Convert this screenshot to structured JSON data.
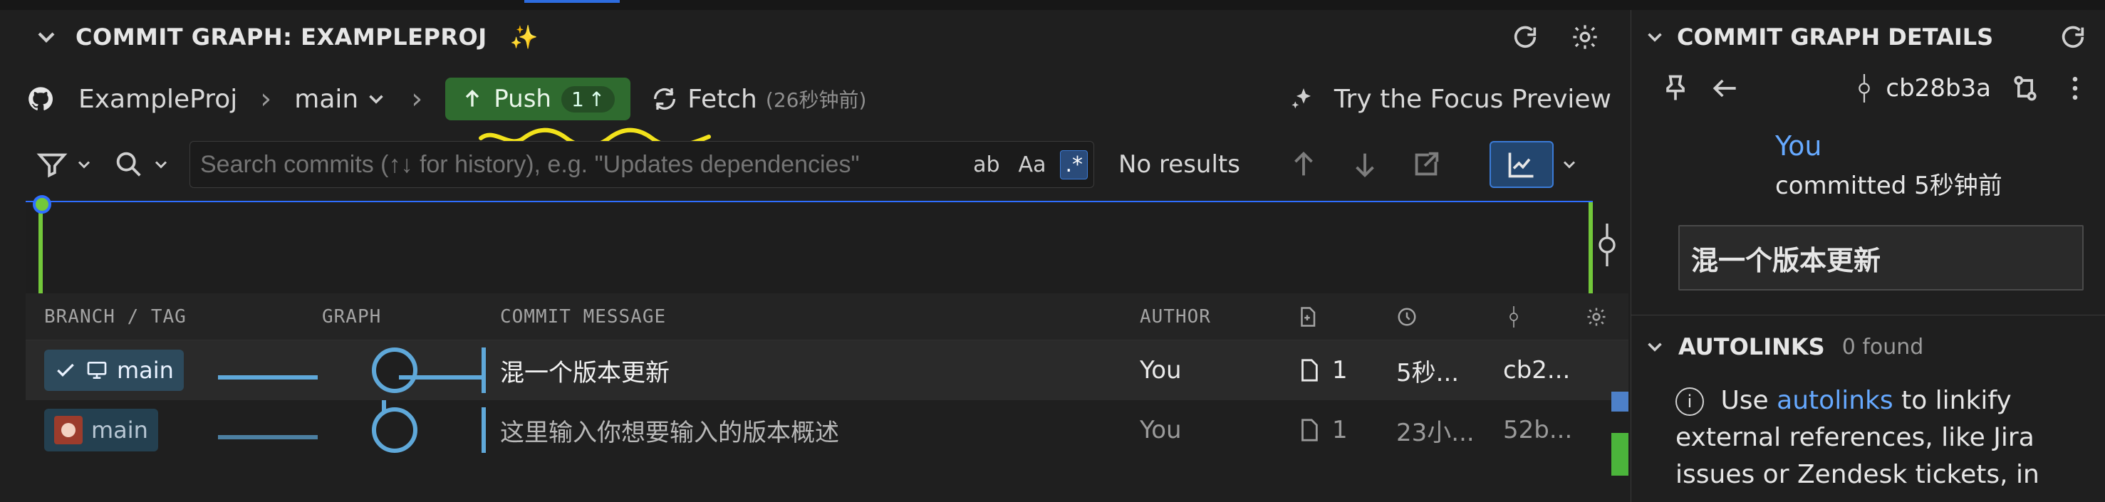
{
  "left_panel": {
    "title": "COMMIT GRAPH: EXAMPLEPROJ",
    "toolbar": {
      "repo": "ExampleProj",
      "branch": "main",
      "push_label": "Push",
      "push_count": "1",
      "fetch_label": "Fetch",
      "fetch_time": "(26秒钟前)",
      "focus_preview": "Try the Focus Preview"
    },
    "search": {
      "placeholder": "Search commits (↑↓ for history), e.g. \"Updates dependencies\"",
      "opt_ab": "ab",
      "opt_case": "Aa",
      "opt_regex": ".*",
      "results": "No results"
    },
    "table": {
      "headers": {
        "branch_tag": "BRANCH / TAG",
        "graph": "GRAPH",
        "commit_message": "COMMIT MESSAGE",
        "author": "AUTHOR"
      },
      "rows": [
        {
          "branch": "main",
          "message": "混一个版本更新",
          "author": "You",
          "files": "1",
          "time": "5秒...",
          "sha": "cb2..."
        },
        {
          "branch": "main",
          "message": "这里输入你想要输入的版本概述",
          "author": "You",
          "files": "1",
          "time": "23小...",
          "sha": "52b..."
        }
      ]
    }
  },
  "right_panel": {
    "title": "COMMIT GRAPH DETAILS",
    "sha": "cb28b3a",
    "author": "You",
    "committed": "committed 5秒钟前",
    "message": "混一个版本更新",
    "autolinks_title": "AUTOLINKS",
    "autolinks_count": "0 found",
    "info_prefix": "Use",
    "info_link": "autolinks",
    "info_rest": "to linkify external references, like Jira issues or Zendesk tickets, in"
  }
}
